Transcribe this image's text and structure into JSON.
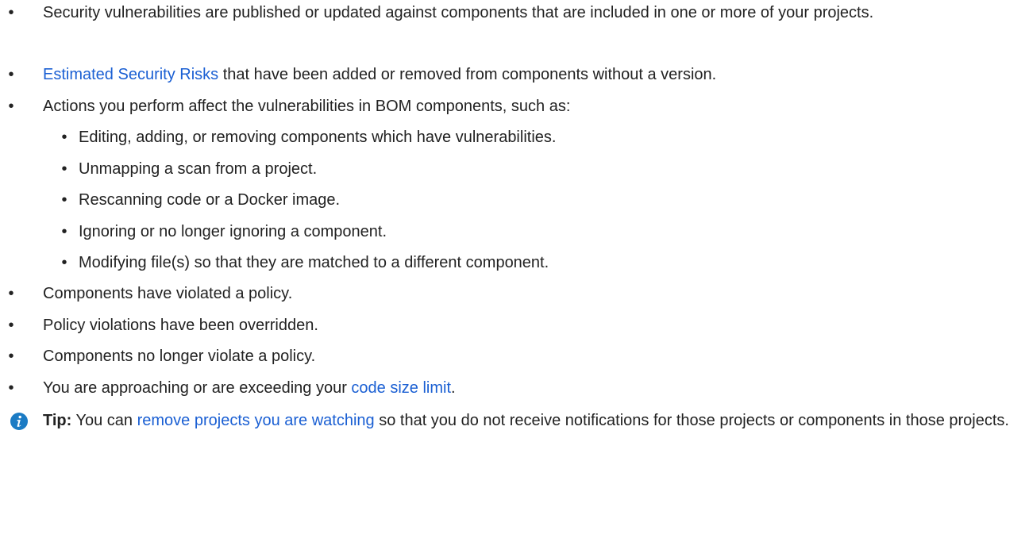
{
  "bullet_glyph": "•",
  "items": [
    {
      "text": "Security vulnerabilities are published or updated against components that are included in one or more of your projects."
    },
    {
      "link": "Estimated Security Risks",
      "after": " that have been added or removed from components without a version."
    },
    {
      "text": "Actions you perform affect the vulnerabilities in BOM components, such as:"
    },
    {
      "text": "Components have violated a policy."
    },
    {
      "text": "Policy violations have been overridden."
    },
    {
      "text": "Components no longer violate a policy."
    },
    {
      "before": "You are approaching or are exceeding your ",
      "link": "code size limit",
      "after": "."
    }
  ],
  "subitems": [
    {
      "text": "Editing, adding, or removing components which have vulnerabilities."
    },
    {
      "text": "Unmapping a scan from a project."
    },
    {
      "text": "Rescanning code or a Docker image."
    },
    {
      "text": "Ignoring or no longer ignoring a component."
    },
    {
      "text": "Modifying file(s) so that they are matched to a different component."
    }
  ],
  "tip": {
    "icon": "info-icon",
    "label": "Tip:",
    "before": " You can ",
    "link": "remove projects you are watching",
    "after": " so that you do not receive notifications for those projects or components in those projects."
  },
  "colors": {
    "text": "#222222",
    "link": "#1a5fd3",
    "tip_icon": "#1b7bc4"
  }
}
